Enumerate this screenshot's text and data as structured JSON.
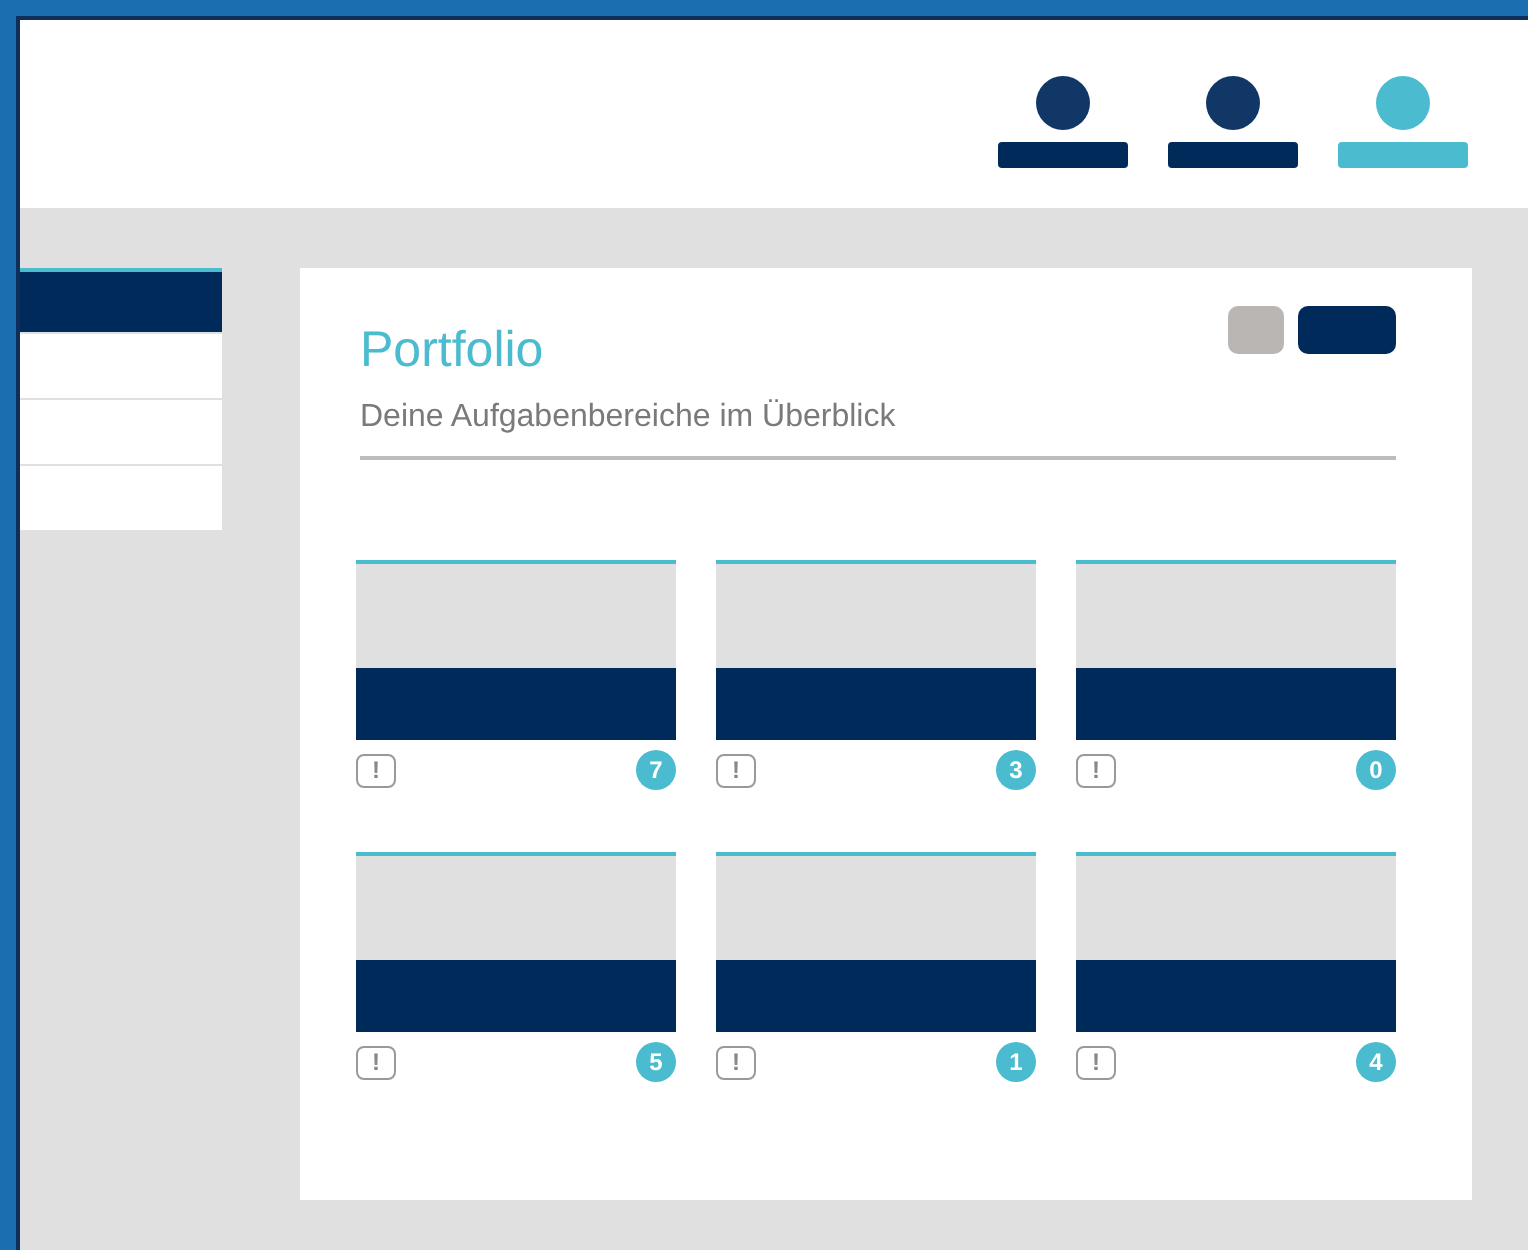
{
  "header": {
    "users": [
      {
        "selected": false
      },
      {
        "selected": false
      },
      {
        "selected": true
      }
    ]
  },
  "sidebar": {
    "items": [
      {
        "selected": true
      },
      {
        "selected": false
      },
      {
        "selected": false
      },
      {
        "selected": false
      }
    ]
  },
  "panel": {
    "title": "Portfolio",
    "subtitle": "Deine Aufgabenbereiche im Überblick",
    "buttons": [
      {
        "kind": "secondary"
      },
      {
        "kind": "primary"
      }
    ],
    "cards": [
      {
        "alert": "!",
        "count": "7"
      },
      {
        "alert": "!",
        "count": "3"
      },
      {
        "alert": "!",
        "count": "0"
      },
      {
        "alert": "!",
        "count": "5"
      },
      {
        "alert": "!",
        "count": "1"
      },
      {
        "alert": "!",
        "count": "4"
      }
    ]
  }
}
